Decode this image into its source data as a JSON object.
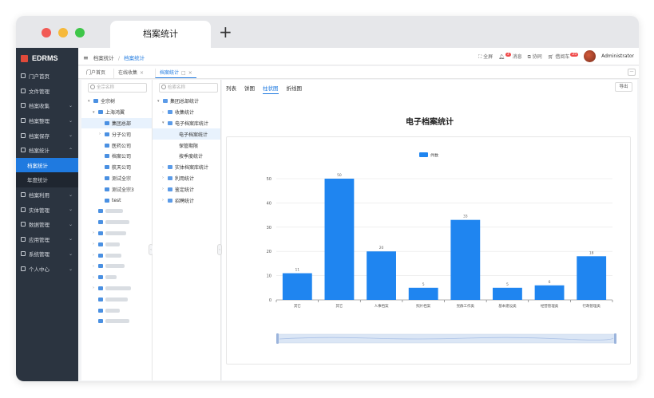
{
  "browser": {
    "tab_title": "档案统计",
    "new_tab": "+"
  },
  "app": {
    "logo": "EDRMS"
  },
  "sidebar": {
    "items": [
      {
        "label": "门户首页",
        "chevron": ""
      },
      {
        "label": "文件管理",
        "chevron": ""
      },
      {
        "label": "档案收集",
        "chevron": "⌄"
      },
      {
        "label": "档案整理",
        "chevron": "⌄"
      },
      {
        "label": "档案保存",
        "chevron": "⌄"
      },
      {
        "label": "档案统计",
        "chevron": "⌃"
      }
    ],
    "sub_items": [
      {
        "label": "档案统计",
        "active": true
      },
      {
        "label": "年度统计",
        "active": false
      }
    ],
    "items_after": [
      {
        "label": "档案利用",
        "chevron": "⌄"
      },
      {
        "label": "实体管理",
        "chevron": "⌄"
      },
      {
        "label": "数据管理",
        "chevron": "⌄"
      },
      {
        "label": "应用管理",
        "chevron": "⌄"
      },
      {
        "label": "系统管理",
        "chevron": "⌄"
      },
      {
        "label": "个人中心",
        "chevron": "⌄"
      }
    ]
  },
  "header": {
    "menu_icon": "≡",
    "breadcrumb_1": "档案统计",
    "breadcrumb_sep": "/",
    "breadcrumb_2": "档案统计",
    "fullscreen": "全屏",
    "messages": "消息",
    "messages_badge": "3",
    "collab": "协同",
    "borrow_cart": "借阅车",
    "borrow_badge": "25",
    "user": "Administrator"
  },
  "page_tabs": {
    "tab1": "门户首页",
    "tab2": "在线收集",
    "tab3": "档案统计",
    "close": "×",
    "restore": "□",
    "collapse": "—"
  },
  "tree1": {
    "search_placeholder": "全宗名称",
    "root": "全宗树",
    "company": "上海鸿翼",
    "nodes": [
      "集团总部",
      "分子公司",
      "医药公司",
      "档案公司",
      "航天公司",
      "测试全宗",
      "测试全宗3",
      "test"
    ]
  },
  "tree2": {
    "search_placeholder": "检索名称",
    "root": "集团总部统计",
    "nodes": [
      "收集统计",
      "电子档案库统计"
    ],
    "leaves": [
      "电子档案统计",
      "保管期限",
      "按季度统计"
    ],
    "nodes_after": [
      "实体档案库统计",
      "利用统计",
      "鉴定统计",
      "招聘统计"
    ]
  },
  "content": {
    "tabs": [
      "列表",
      "饼图",
      "柱状图",
      "折线图"
    ],
    "active_tab": "柱状图",
    "export_label": "导出",
    "title": "电子档案统计"
  },
  "chart_data": {
    "type": "bar",
    "title": "电子档案统计",
    "legend": [
      "件数"
    ],
    "legend_position": "top-center",
    "categories": [
      "其它",
      "其它",
      "人事档案",
      "照片档案",
      "党群工作类",
      "基本建设类",
      "经营管理类",
      "行政管理类"
    ],
    "values": [
      11,
      50,
      20,
      5,
      33,
      5,
      6,
      18
    ],
    "ylim": [
      0,
      50
    ],
    "yticks": [
      0,
      10,
      20,
      30,
      40,
      50
    ],
    "grid": true,
    "bar_color": "#1f85f0"
  }
}
